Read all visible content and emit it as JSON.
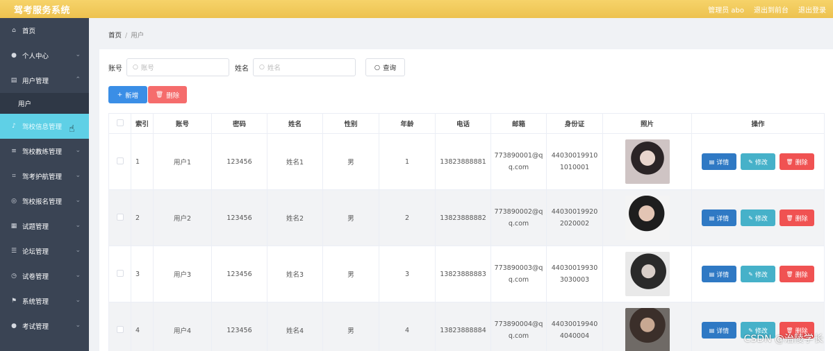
{
  "header": {
    "app_title": "驾考服务系统",
    "admin_label": "管理员 abo",
    "back_to_console": "退出到前台",
    "logout": "退出登录"
  },
  "sidebar": {
    "items": [
      {
        "label": "首页",
        "icon": "home-icon"
      },
      {
        "label": "个人中心",
        "icon": "user-icon"
      },
      {
        "label": "用户管理",
        "icon": "list-icon"
      },
      {
        "label": "驾校信息管理",
        "icon": "mic-icon"
      },
      {
        "label": "驾校教练管理",
        "icon": "menu-icon"
      },
      {
        "label": "驾考护航管理",
        "icon": "crop-icon"
      },
      {
        "label": "驾校报名管理",
        "icon": "globe-icon"
      },
      {
        "label": "试题管理",
        "icon": "document-icon"
      },
      {
        "label": "论坛管理",
        "icon": "sliders-icon"
      },
      {
        "label": "试卷管理",
        "icon": "clock-icon"
      },
      {
        "label": "系统管理",
        "icon": "flag-icon"
      },
      {
        "label": "考试管理",
        "icon": "user-icon"
      }
    ],
    "sub_item": "用户"
  },
  "breadcrumb": {
    "home": "首页",
    "separator": "/",
    "current": "用户"
  },
  "search": {
    "account_label": "账号",
    "account_placeholder": "账号",
    "name_label": "姓名",
    "name_placeholder": "姓名",
    "query_button": "查询"
  },
  "actions": {
    "add": "新增",
    "delete": "删除"
  },
  "table": {
    "columns": [
      "索引",
      "账号",
      "密码",
      "姓名",
      "性别",
      "年龄",
      "电话",
      "邮箱",
      "身份证",
      "照片",
      "操作"
    ],
    "rows": [
      {
        "index": "1",
        "account": "用户1",
        "password": "123456",
        "name": "姓名1",
        "gender": "男",
        "age": "1",
        "phone": "13823888881",
        "email": "773890001@qq.com",
        "idcard": "440300199101010001"
      },
      {
        "index": "2",
        "account": "用户2",
        "password": "123456",
        "name": "姓名2",
        "gender": "男",
        "age": "2",
        "phone": "13823888882",
        "email": "773890002@qq.com",
        "idcard": "440300199202020002"
      },
      {
        "index": "3",
        "account": "用户3",
        "password": "123456",
        "name": "姓名3",
        "gender": "男",
        "age": "3",
        "phone": "13823888883",
        "email": "773890003@qq.com",
        "idcard": "440300199303030003"
      },
      {
        "index": "4",
        "account": "用户4",
        "password": "123456",
        "name": "姓名4",
        "gender": "男",
        "age": "4",
        "phone": "13823888884",
        "email": "773890004@qq.com",
        "idcard": "440300199404040004"
      }
    ],
    "row_actions": {
      "detail": "详情",
      "edit": "修改",
      "delete": "删除"
    }
  },
  "watermark": "CSDN @治陵学长",
  "colors": {
    "header": "#edc24f",
    "sidebar": "#3a4454",
    "active_menu": "#5fd0e6",
    "primary": "#3a8ee6",
    "danger": "#f56c6c",
    "edit": "#46b1c9"
  }
}
